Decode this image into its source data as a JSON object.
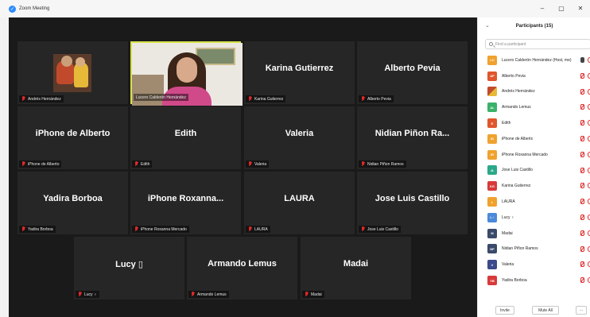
{
  "window": {
    "title": "Zoom Meeting",
    "logo_glyph": "✓",
    "minimize": "–",
    "maximize": "▢",
    "close": "✕"
  },
  "gallery": {
    "tiles": [
      {
        "name": "",
        "label": "Andrés Hernández",
        "type": "photo"
      },
      {
        "name": "",
        "label": "Lucero Calderón Hernández",
        "type": "video",
        "active": true
      },
      {
        "name": "Karina Gutierrez",
        "label": "Karina Gutierrez"
      },
      {
        "name": "Alberto Pevia",
        "label": "Alberto Pevia"
      },
      {
        "name": "iPhone de Alberto",
        "label": "iPhone de Alberto"
      },
      {
        "name": "Edith",
        "label": "Edith"
      },
      {
        "name": "Valeria",
        "label": "Valeria"
      },
      {
        "name": "Nidian Piñon Ra...",
        "label": "Nidian Piñon Ramos"
      },
      {
        "name": "Yadira Borboa",
        "label": "Yadira Borboa"
      },
      {
        "name": "iPhone Roxanna...",
        "label": "iPhone Roxanna Mercado"
      },
      {
        "name": "LAURA",
        "label": "LAURA"
      },
      {
        "name": "Jose Luis Castillo",
        "label": "Jose Luis Castillo"
      },
      {
        "name": "Lucy ▯",
        "label": "Lucy ♀"
      },
      {
        "name": "Armando Lemus",
        "label": "Armando Lemus"
      },
      {
        "name": "Madai",
        "label": "Madai"
      }
    ]
  },
  "participants_panel": {
    "title": "Participants (15)",
    "collapse_glyph": "⌄",
    "search_placeholder": "Find a participant",
    "participants": [
      {
        "initials": "LC",
        "color": "#f0a22e",
        "name": "Lucero Calderón Hernández (Host, me)",
        "mic": "on"
      },
      {
        "initials": "AP",
        "color": "#e0562c",
        "name": "Alberto Pevia",
        "mic": "muted"
      },
      {
        "initials": "",
        "color": "#8a3a2a",
        "name": "Andrés Hernández",
        "mic": "muted",
        "photo": true
      },
      {
        "initials": "AL",
        "color": "#3ab26a",
        "name": "Armando Lemus",
        "mic": "muted"
      },
      {
        "initials": "E",
        "color": "#e0562c",
        "name": "Edith",
        "mic": "muted"
      },
      {
        "initials": "ID",
        "color": "#f0a22e",
        "name": "iPhone de Alberto",
        "mic": "muted"
      },
      {
        "initials": "IR",
        "color": "#f0a22e",
        "name": "iPhone Roxanna Mercado",
        "mic": "muted"
      },
      {
        "initials": "JL",
        "color": "#2aa88a",
        "name": "Jose Luis Castillo",
        "mic": "muted"
      },
      {
        "initials": "KG",
        "color": "#d83a3a",
        "name": "Karina Gutierrez",
        "mic": "muted"
      },
      {
        "initials": "L",
        "color": "#f0a22e",
        "name": "LAURA",
        "mic": "muted"
      },
      {
        "initials": "L♀",
        "color": "#4a8ad8",
        "name": "Lucy ♀",
        "mic": "muted"
      },
      {
        "initials": "M",
        "color": "#3a4a6a",
        "name": "Madai",
        "mic": "muted"
      },
      {
        "initials": "NP",
        "color": "#3a4a6a",
        "name": "Nidian Piñon Ramos",
        "mic": "muted"
      },
      {
        "initials": "V",
        "color": "#3a4a8a",
        "name": "Valeria",
        "mic": "muted"
      },
      {
        "initials": "YB",
        "color": "#d83a3a",
        "name": "Yadira Borboa",
        "mic": "muted"
      }
    ],
    "invite_label": "Invite",
    "mute_all_label": "Mute All",
    "more_label": "···"
  }
}
